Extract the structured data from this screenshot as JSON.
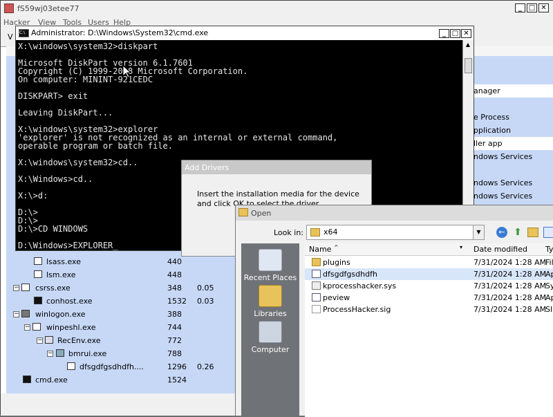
{
  "main": {
    "title": "fS59wj03etee77",
    "menus": [
      "Hacker",
      "View",
      "Tools",
      "Users",
      "Help"
    ],
    "tab_partial": "V",
    "processes": [
      {
        "name": "lsass.exe",
        "pid": "440",
        "cpu": ""
      },
      {
        "name": "lsm.exe",
        "pid": "448",
        "cpu": ""
      },
      {
        "name": "csrss.exe",
        "pid": "348",
        "cpu": "0.05"
      },
      {
        "name": "conhost.exe",
        "pid": "1532",
        "cpu": "0.03"
      },
      {
        "name": "winlogon.exe",
        "pid": "388",
        "cpu": ""
      },
      {
        "name": "winpeshl.exe",
        "pid": "744",
        "cpu": ""
      },
      {
        "name": "RecEnv.exe",
        "pid": "772",
        "cpu": ""
      },
      {
        "name": "bmrui.exe",
        "pid": "788",
        "cpu": ""
      },
      {
        "name": "dfsgdfgsdhdfh....",
        "pid": "1296",
        "cpu": "0.26"
      },
      {
        "name": "cmd.exe",
        "pid": "1524",
        "cpu": ""
      }
    ],
    "services_partial": [
      "anager",
      "e Process",
      "pplication",
      "ller app",
      "ndows Services",
      "ndows Services",
      "ndows Services"
    ]
  },
  "cmd": {
    "title": "Administrator: D:\\Windows\\System32\\cmd.exe",
    "lines": [
      "X:\\windows\\system32>diskpart",
      "",
      "Microsoft DiskPart version 6.1.7601",
      "Copyright (C) 1999-2008 Microsoft Corporation.",
      "On computer: MININT-921CEDC",
      "",
      "DISKPART> exit",
      "",
      "Leaving DiskPart...",
      "",
      "X:\\windows\\system32>explorer",
      "'explorer' is not recognized as an internal or external command,",
      "operable program or batch file.",
      "",
      "X:\\windows\\system32>cd..",
      "",
      "X:\\Windows>cd..",
      "",
      "X:\\>d:",
      "",
      "D:\\>",
      "D:\\>",
      "D:\\>CD WINDOWS",
      "",
      "D:\\Windows>EXPLORER_"
    ]
  },
  "add_drivers": {
    "title": "Add Drivers",
    "message": "Insert the installation media for the device and click OK to select the driver."
  },
  "open_dialog": {
    "title": "Open",
    "look_in_label": "Look in:",
    "look_in_value": "x64",
    "places": [
      "Recent Places",
      "Libraries",
      "Computer"
    ],
    "columns": [
      "Name",
      "Date modified",
      "Ty"
    ],
    "files": [
      {
        "name": "plugins",
        "date": "7/31/2024 1:28 AM",
        "type": "Fil",
        "kind": "folder"
      },
      {
        "name": "dfsgdfgsdhdfh",
        "date": "7/31/2024 1:28 AM",
        "type": "Ap",
        "kind": "app"
      },
      {
        "name": "kprocesshacker.sys",
        "date": "7/31/2024 1:28 AM",
        "type": "Sy",
        "kind": "sys"
      },
      {
        "name": "peview",
        "date": "7/31/2024 1:28 AM",
        "type": "Ap",
        "kind": "app"
      },
      {
        "name": "ProcessHacker.sig",
        "date": "7/31/2024 1:28 AM",
        "type": "SI",
        "kind": "file"
      }
    ]
  },
  "colors": {
    "selection": "#c7d8f7",
    "console_bg": "#000000",
    "folder": "#e8c25a"
  }
}
